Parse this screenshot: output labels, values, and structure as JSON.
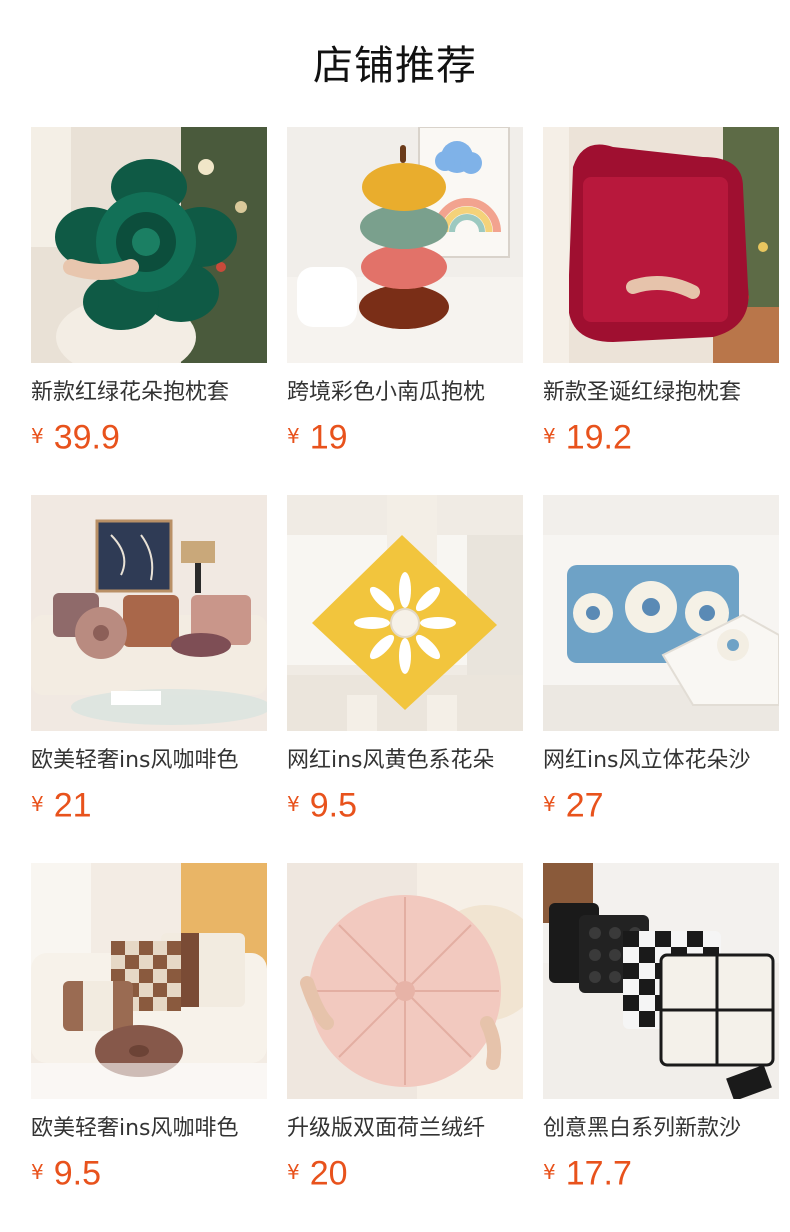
{
  "section": {
    "title": "店铺推荐"
  },
  "colors": {
    "price": "#e8521c",
    "title": "#111111",
    "name": "#333333"
  },
  "products": [
    {
      "name": "新款红绿花朵抱枕套",
      "currency": "¥",
      "price": "39.9",
      "image": "green-flower-pillow"
    },
    {
      "name": "跨境彩色小南瓜抱枕",
      "currency": "¥",
      "price": "19",
      "image": "stacked-pumpkin-pillows"
    },
    {
      "name": "新款圣诞红绿抱枕套",
      "currency": "¥",
      "price": "19.2",
      "image": "red-ruffle-pillow"
    },
    {
      "name": "欧美轻奢ins风咖啡色",
      "currency": "¥",
      "price": "21",
      "image": "living-room-pillows"
    },
    {
      "name": "网红ins风黄色系花朵",
      "currency": "¥",
      "price": "9.5",
      "image": "yellow-daisy-pillow"
    },
    {
      "name": "网红ins风立体花朵沙",
      "currency": "¥",
      "price": "27",
      "image": "blue-flower-pillow"
    },
    {
      "name": "欧美轻奢ins风咖啡色",
      "currency": "¥",
      "price": "9.5",
      "image": "brown-check-pillows"
    },
    {
      "name": "升级版双面荷兰绒纤",
      "currency": "¥",
      "price": "20",
      "image": "pink-round-pillow"
    },
    {
      "name": "创意黑白系列新款沙",
      "currency": "¥",
      "price": "17.7",
      "image": "black-white-pillows"
    }
  ]
}
